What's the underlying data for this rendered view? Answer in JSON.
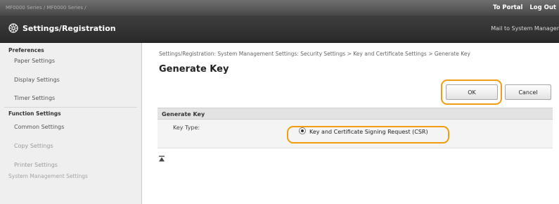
{
  "topbar": {
    "model_text": "MF0000 Series / MF0000 Series /",
    "portal_link": "To Portal",
    "logout_link": "Log Out"
  },
  "header": {
    "title": "Settings/Registration",
    "mail_link": "Mail to System Manager"
  },
  "sidebar": {
    "sections": [
      {
        "label": "Preferences",
        "items": [
          "Paper Settings",
          "Display Settings",
          "Timer Settings"
        ]
      },
      {
        "label": "Function Settings",
        "items": [
          "Common Settings",
          "Copy Settings",
          "Printer Settings"
        ]
      },
      {
        "label": "System Management Settings",
        "items": []
      }
    ]
  },
  "main": {
    "breadcrumb": "Settings/Registration: System Management Settings: Security Settings > Key and Certificate Settings > Generate Key",
    "page_title": "Generate Key",
    "ok_label": "OK",
    "cancel_label": "Cancel",
    "section_title": "Generate Key",
    "key_type_label": "Key Type:",
    "key_type_option": "Key and Certificate Signing Request (CSR)",
    "key_type_selected": true
  },
  "colors": {
    "highlight": "#f39c12",
    "header_bg": "#2f2f2f",
    "sidebar_bg": "#efefef"
  }
}
